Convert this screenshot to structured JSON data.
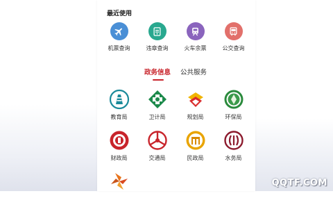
{
  "recent": {
    "title": "最近使用",
    "items": [
      {
        "label": "机票查询",
        "icon": "airplane-icon",
        "color": "#4a8fd6"
      },
      {
        "label": "违章查询",
        "icon": "ticket-icon",
        "color": "#29a88f"
      },
      {
        "label": "火车余票",
        "icon": "train-icon",
        "color": "#8a64bd"
      },
      {
        "label": "公交查询",
        "icon": "bus-icon",
        "color": "#e2706b"
      }
    ]
  },
  "tabs": {
    "active": "政务信息",
    "inactive": "公共服务",
    "accent_color": "#c8242b"
  },
  "departments": [
    {
      "label": "教育局",
      "icon": "education-bureau-emblem"
    },
    {
      "label": "卫计局",
      "icon": "health-bureau-emblem"
    },
    {
      "label": "规划局",
      "icon": "planning-bureau-emblem"
    },
    {
      "label": "环保局",
      "icon": "environment-bureau-emblem"
    },
    {
      "label": "财政局",
      "icon": "finance-bureau-emblem"
    },
    {
      "label": "交通局",
      "icon": "transport-bureau-emblem"
    },
    {
      "label": "民政局",
      "icon": "civil-affairs-bureau-emblem"
    },
    {
      "label": "水务局",
      "icon": "water-bureau-emblem"
    },
    {
      "label": "",
      "icon": "partial-bureau-emblem"
    }
  ],
  "watermark": "QQTF.COM"
}
